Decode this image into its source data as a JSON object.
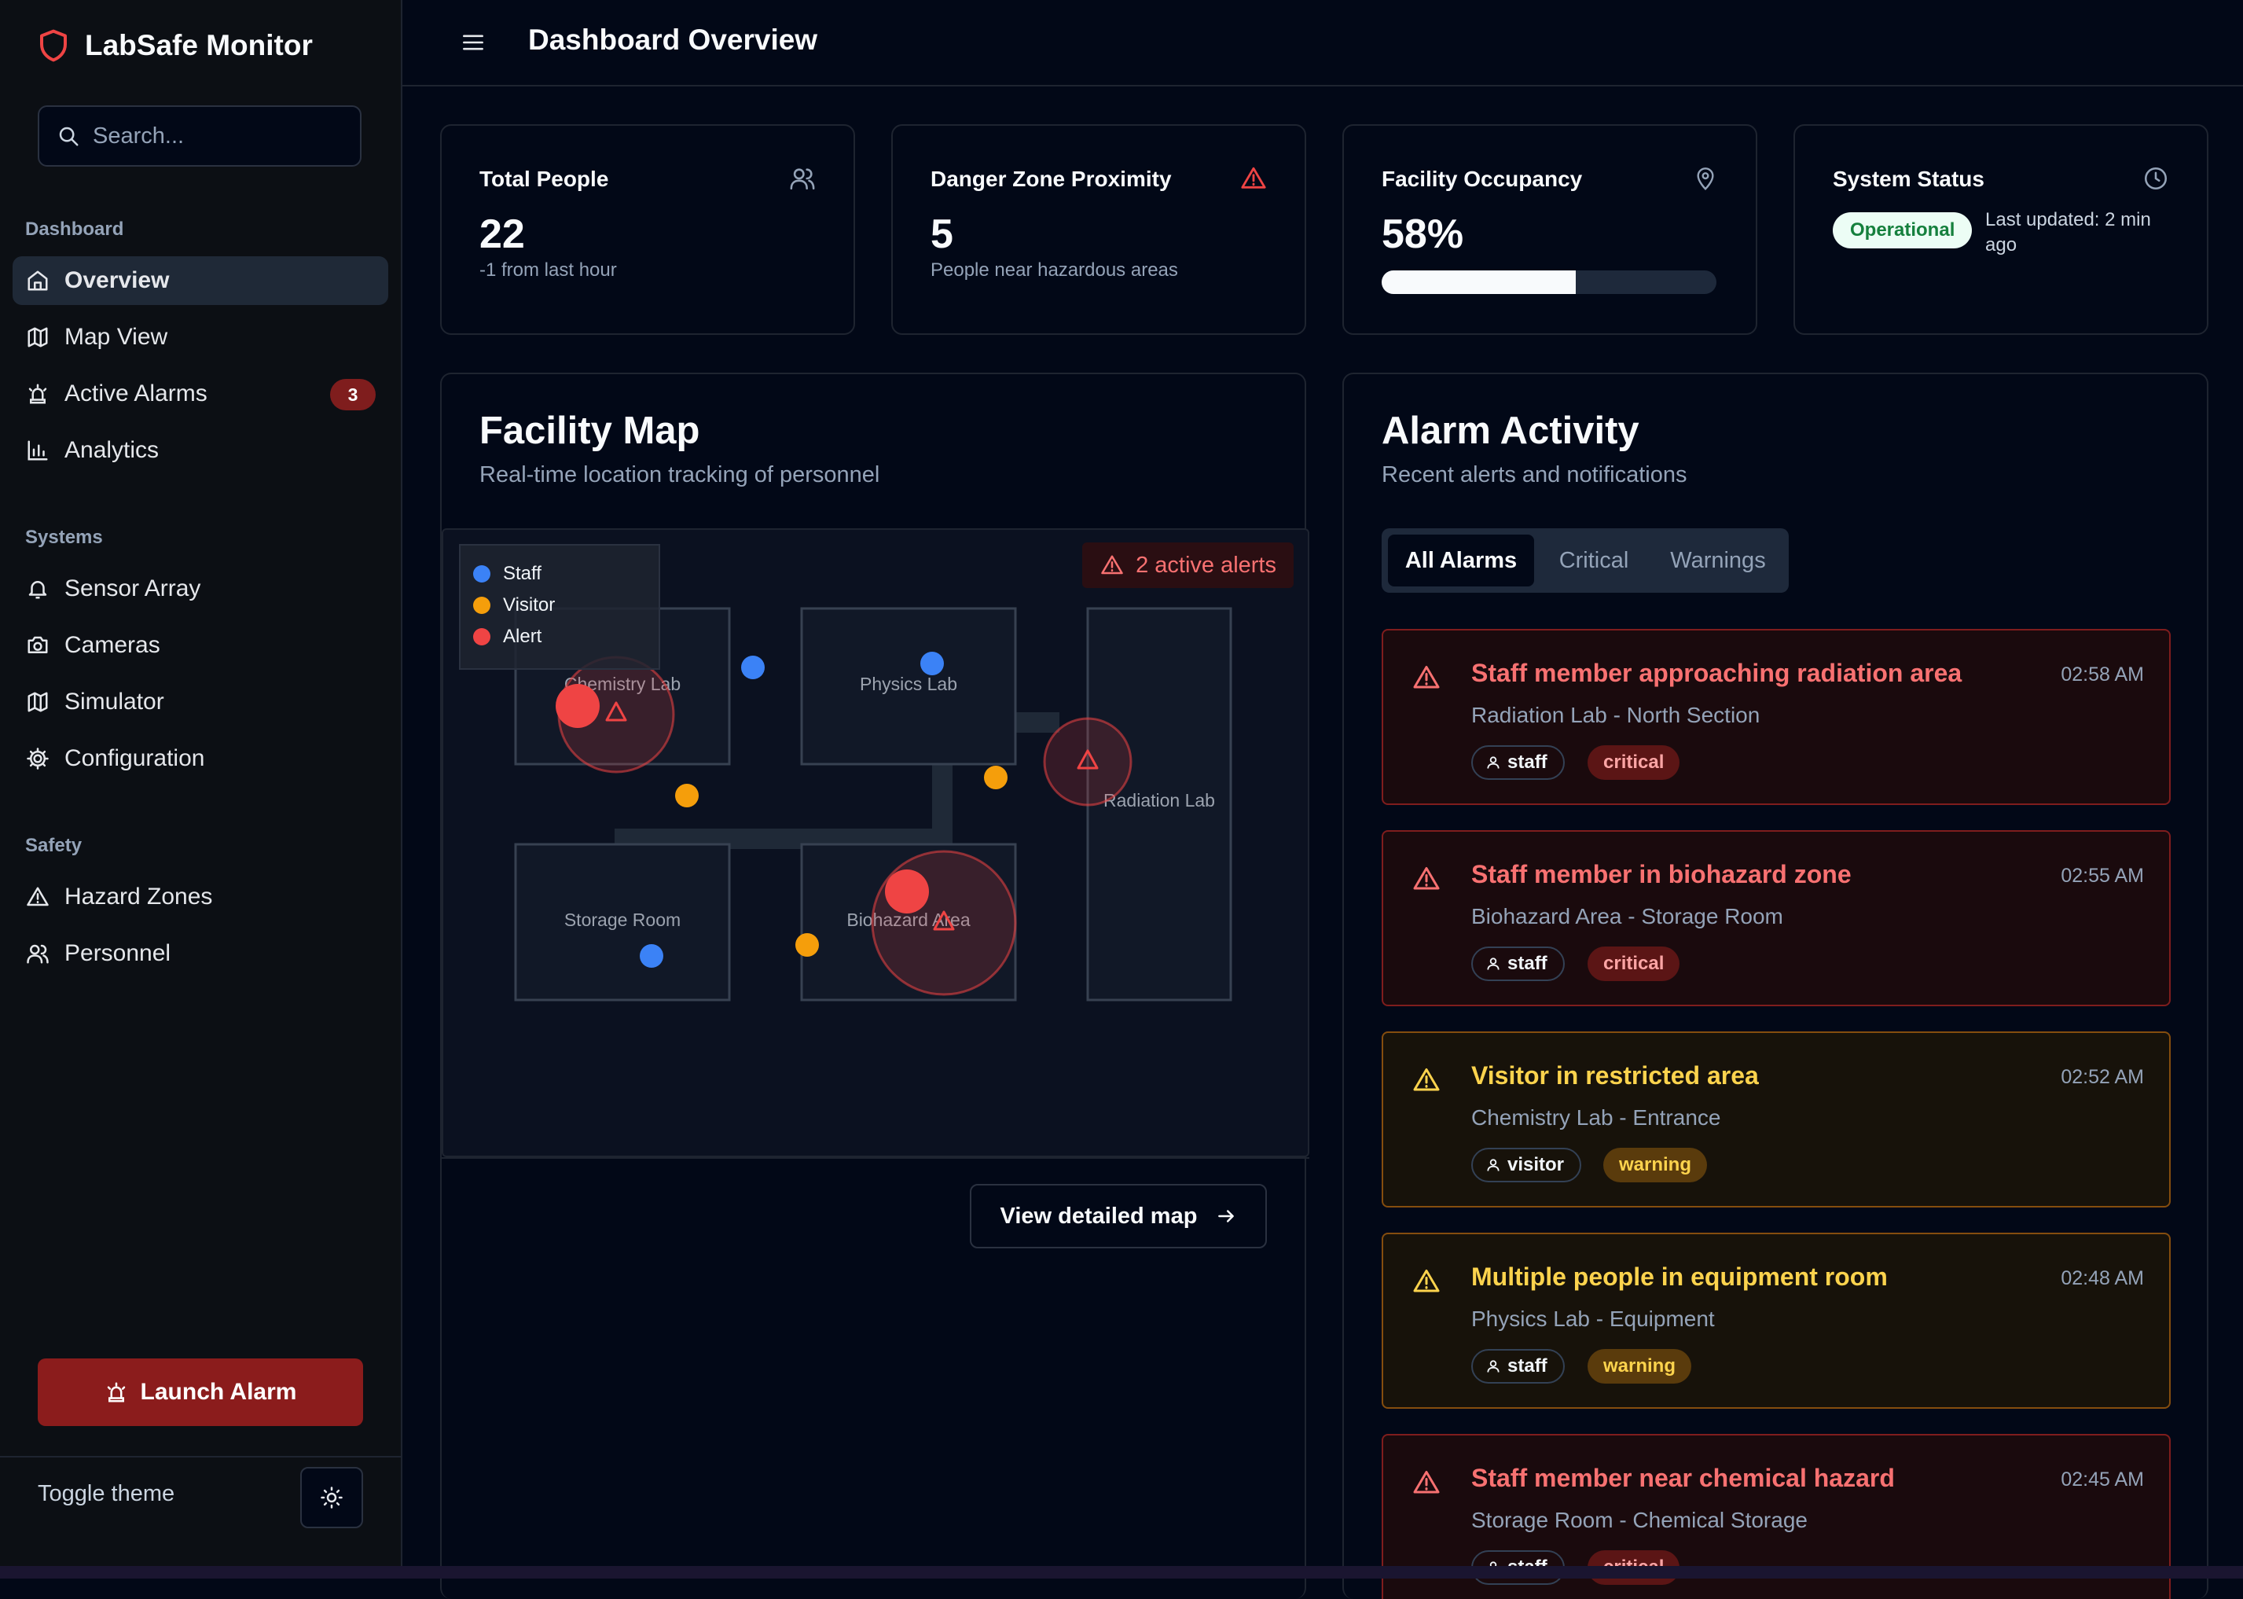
{
  "brand": {
    "title": "LabSafe Monitor",
    "icon": "shield-icon",
    "accent": "#ef4444"
  },
  "search": {
    "placeholder": "Search..."
  },
  "sidebar": {
    "groups": [
      {
        "title": "Dashboard",
        "items": [
          {
            "label": "Overview",
            "icon": "home-icon",
            "active": true
          },
          {
            "label": "Map View",
            "icon": "map-icon"
          },
          {
            "label": "Active Alarms",
            "icon": "siren-icon",
            "badge": "3"
          },
          {
            "label": "Analytics",
            "icon": "bar-chart-icon"
          }
        ]
      },
      {
        "title": "Systems",
        "items": [
          {
            "label": "Sensor Array",
            "icon": "bell-icon"
          },
          {
            "label": "Cameras",
            "icon": "camera-icon"
          },
          {
            "label": "Simulator",
            "icon": "map-icon"
          },
          {
            "label": "Configuration",
            "icon": "gear-icon"
          }
        ]
      },
      {
        "title": "Safety",
        "items": [
          {
            "label": "Hazard Zones",
            "icon": "warning-triangle-icon"
          },
          {
            "label": "Personnel",
            "icon": "users-icon"
          }
        ]
      }
    ],
    "launch_label": "Launch Alarm",
    "toggle_label": "Toggle theme"
  },
  "header": {
    "title": "Dashboard Overview"
  },
  "stats": {
    "total_people": {
      "title": "Total People",
      "value": "22",
      "sub": "-1 from last hour",
      "icon": "users-icon"
    },
    "danger": {
      "title": "Danger Zone Proximity",
      "value": "5",
      "sub": "People near hazardous areas",
      "icon": "warning-triangle-icon"
    },
    "occupancy": {
      "title": "Facility Occupancy",
      "value": "58%",
      "progress": 0.58,
      "icon": "map-pin-icon"
    },
    "system": {
      "title": "System Status",
      "status": "Operational",
      "updated": "Last updated: 2 min ago",
      "icon": "clock-icon"
    }
  },
  "map": {
    "title": "Facility Map",
    "subtitle": "Real-time location tracking of personnel",
    "legend": [
      {
        "label": "Staff",
        "color": "#3b82f6"
      },
      {
        "label": "Visitor",
        "color": "#f59e0b"
      },
      {
        "label": "Alert",
        "color": "#ef4444"
      }
    ],
    "alerts_label": "2 active alerts",
    "rooms": {
      "chemistry": "Chemistry Lab",
      "physics": "Physics Lab",
      "radiation": "Radiation Lab",
      "storage": "Storage Room",
      "biohazard": "Biohazard Area"
    },
    "detail_button": "View detailed map"
  },
  "alarms": {
    "title": "Alarm Activity",
    "subtitle": "Recent alerts and notifications",
    "tabs": [
      "All Alarms",
      "Critical",
      "Warnings"
    ],
    "items": [
      {
        "title": "Staff member approaching radiation area",
        "location": "Radiation Lab - North Section",
        "time": "02:58 AM",
        "role": "staff",
        "severity": "critical"
      },
      {
        "title": "Staff member in biohazard zone",
        "location": "Biohazard Area - Storage Room",
        "time": "02:55 AM",
        "role": "staff",
        "severity": "critical"
      },
      {
        "title": "Visitor in restricted area",
        "location": "Chemistry Lab - Entrance",
        "time": "02:52 AM",
        "role": "visitor",
        "severity": "warning"
      },
      {
        "title": "Multiple people in equipment room",
        "location": "Physics Lab - Equipment",
        "time": "02:48 AM",
        "role": "staff",
        "severity": "warning"
      },
      {
        "title": "Staff member near chemical hazard",
        "location": "Storage Room - Chemical Storage",
        "time": "02:45 AM",
        "role": "staff",
        "severity": "critical"
      }
    ]
  }
}
